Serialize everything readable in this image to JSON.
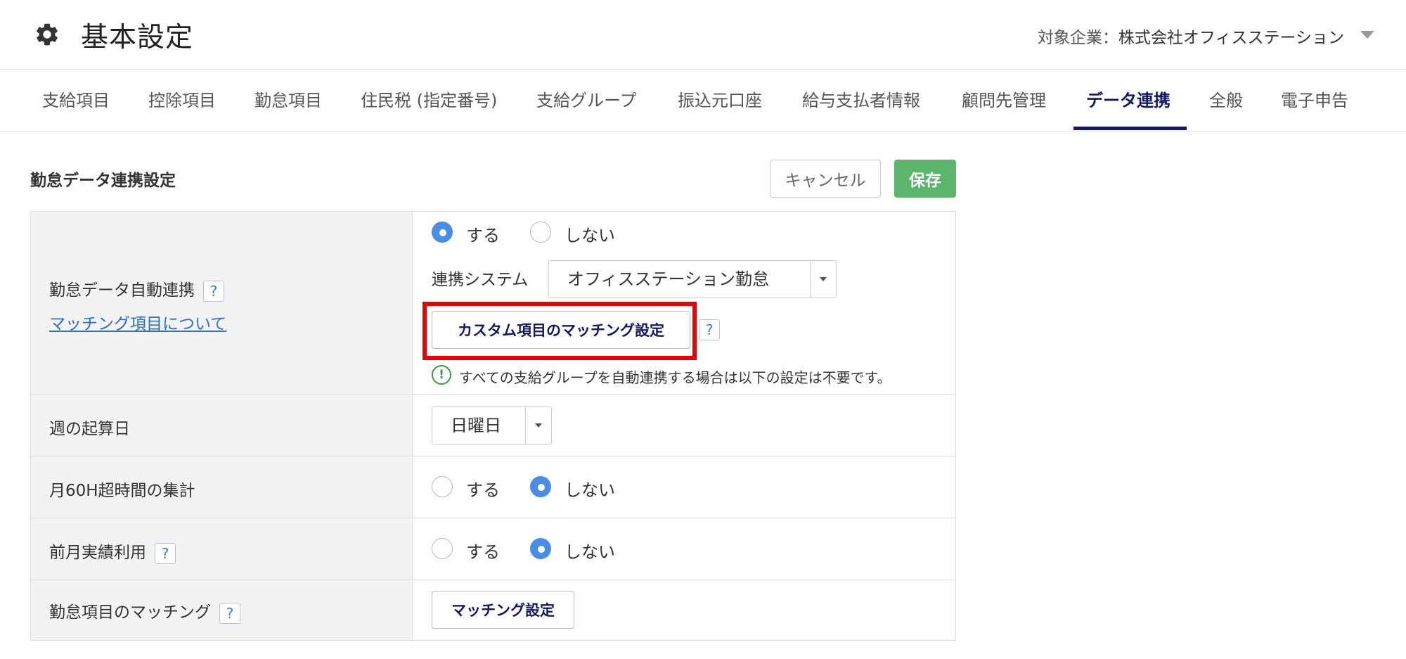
{
  "header": {
    "title": "基本設定",
    "company_label": "対象企業：",
    "company_name": "株式会社オフィスステーション"
  },
  "tabs": [
    {
      "label": "支給項目"
    },
    {
      "label": "控除項目"
    },
    {
      "label": "勤怠項目"
    },
    {
      "label": "住民税 (指定番号)"
    },
    {
      "label": "支給グループ"
    },
    {
      "label": "振込元口座"
    },
    {
      "label": "給与支払者情報"
    },
    {
      "label": "顧問先管理"
    },
    {
      "label": "データ連携",
      "active": true
    },
    {
      "label": "全般"
    },
    {
      "label": "電子申告"
    }
  ],
  "section": {
    "title": "勤怠データ連携設定",
    "cancel_label": "キャンセル",
    "save_label": "保存"
  },
  "rows": {
    "auto_link": {
      "label": "勤怠データ自動連携",
      "help": "?",
      "link": "マッチング項目について",
      "option_yes": "する",
      "option_no": "しない",
      "selected": "する",
      "system_label": "連携システム",
      "system_value": "オフィスステーション勤怠",
      "custom_button": "カスタム項目のマッチング設定",
      "custom_help": "?",
      "info_icon": "!",
      "info_text": "すべての支給グループを自動連携する場合は以下の設定は不要です。"
    },
    "week_start": {
      "label": "週の起算日",
      "value": "日曜日"
    },
    "overtime60": {
      "label": "月60H超時間の集計",
      "option_yes": "する",
      "option_no": "しない",
      "selected": "しない"
    },
    "prev_month": {
      "label": "前月実績利用",
      "help": "?",
      "option_yes": "する",
      "option_no": "しない",
      "selected": "しない"
    },
    "matching": {
      "label": "勤怠項目のマッチング",
      "help": "?",
      "button": "マッチング設定"
    }
  },
  "colors": {
    "accent": "#141763",
    "save": "#5bb56a",
    "radio": "#4a8de6",
    "highlight": "#ee0000",
    "link": "#2f6fd1"
  },
  "icons": {
    "settings": "gear-icon",
    "company_dropdown": "chevron-down-icon",
    "info": "info-icon"
  }
}
